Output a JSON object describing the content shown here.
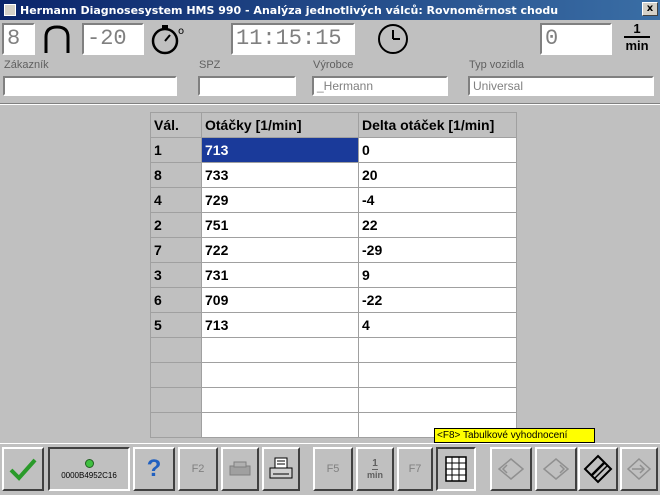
{
  "window": {
    "title": "Hermann Diagnosesystem HMS 990 - Analýza jednotlivých válců: Rovnoměrnost chodu",
    "close": "x"
  },
  "topbar": {
    "cylinders": "8",
    "temperature": "-20",
    "time": "11:15:15",
    "rpm": "0",
    "rpm_unit_top": "1",
    "rpm_unit_bottom": "min"
  },
  "fields": {
    "customer": {
      "label": "Zákazník",
      "value": ""
    },
    "plate": {
      "label": "SPZ",
      "value": ""
    },
    "manufacturer": {
      "label": "Výrobce",
      "value": "_Hermann"
    },
    "vehicle_type": {
      "label": "Typ vozidla",
      "value": "Universal"
    }
  },
  "table": {
    "headers": [
      "Vál.",
      "Otáčky [1/min]",
      "Delta otáček [1/min]"
    ],
    "rows": [
      [
        "1",
        "713",
        "0"
      ],
      [
        "8",
        "733",
        "20"
      ],
      [
        "4",
        "729",
        "-4"
      ],
      [
        "2",
        "751",
        "22"
      ],
      [
        "7",
        "722",
        "-29"
      ],
      [
        "3",
        "731",
        "9"
      ],
      [
        "6",
        "709",
        "-22"
      ],
      [
        "5",
        "713",
        "4"
      ]
    ],
    "selected_row": 0
  },
  "tooltip": "<F8> Tabulkové vyhodnocení",
  "bottombar": {
    "status_code": "0000B4952C16",
    "f2": "F2",
    "f5": "F5",
    "f7": "F7",
    "unit_top": "1",
    "unit_bottom": "min",
    "help": "?"
  },
  "colors": {
    "title_bg": "#0a246a",
    "selection": "#1a3a9a",
    "tooltip": "#ffff00",
    "ok_green": "#2a9a2a"
  }
}
